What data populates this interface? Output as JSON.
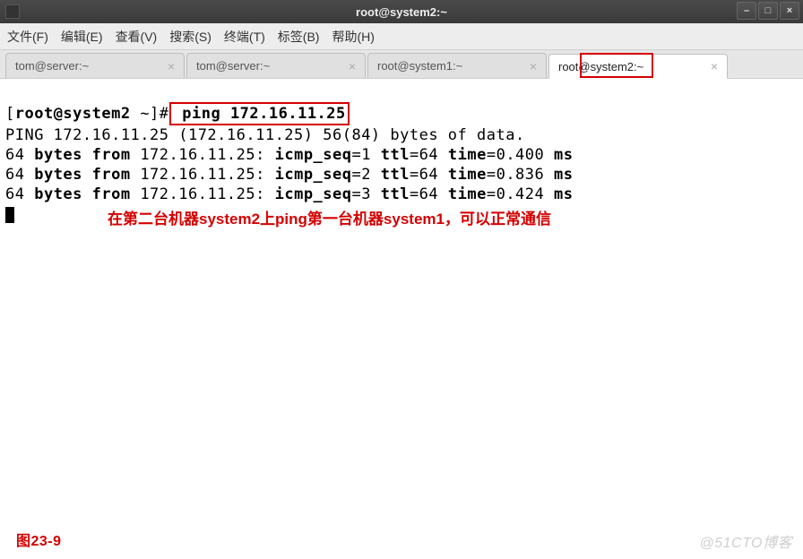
{
  "titlebar": {
    "title": "root@system2:~"
  },
  "window_controls": {
    "minimize": "–",
    "maximize": "□",
    "close": "×"
  },
  "menubar": {
    "items": [
      "文件(F)",
      "编辑(E)",
      "查看(V)",
      "搜索(S)",
      "终端(T)",
      "标签(B)",
      "帮助(H)"
    ]
  },
  "tabs": [
    {
      "label": "tom@server:~",
      "active": false
    },
    {
      "label": "tom@server:~",
      "active": false
    },
    {
      "label": "root@system1:~",
      "active": false
    },
    {
      "label": "root@system2:~",
      "active": true
    }
  ],
  "terminal": {
    "prompt_open": "[",
    "prompt_user": "root@system2",
    "prompt_path": " ~]#",
    "command": " ping 172.16.11.25",
    "ping_header": "PING 172.16.11.25 (172.16.11.25) 56(84) bytes of data.",
    "replies": [
      {
        "prefix": "64 ",
        "bytes_from": "bytes from",
        "ip": " 172.16.11.25: ",
        "seq_key": "icmp_seq",
        "seq_eq": "=1 ",
        "ttl_key": "ttl",
        "ttl_eq": "=64 ",
        "time_key": "time",
        "time_eq": "=0.400 ",
        "ms": "ms"
      },
      {
        "prefix": "64 ",
        "bytes_from": "bytes from",
        "ip": " 172.16.11.25: ",
        "seq_key": "icmp_seq",
        "seq_eq": "=2 ",
        "ttl_key": "ttl",
        "ttl_eq": "=64 ",
        "time_key": "time",
        "time_eq": "=0.836 ",
        "ms": "ms"
      },
      {
        "prefix": "64 ",
        "bytes_from": "bytes from",
        "ip": " 172.16.11.25: ",
        "seq_key": "icmp_seq",
        "seq_eq": "=3 ",
        "ttl_key": "ttl",
        "ttl_eq": "=64 ",
        "time_key": "time",
        "time_eq": "=0.424 ",
        "ms": "ms"
      }
    ]
  },
  "annotation": "在第二台机器system2上ping第一台机器system1，可以正常通信",
  "figure_label": "图23-9",
  "watermark": "@51CTO博客"
}
